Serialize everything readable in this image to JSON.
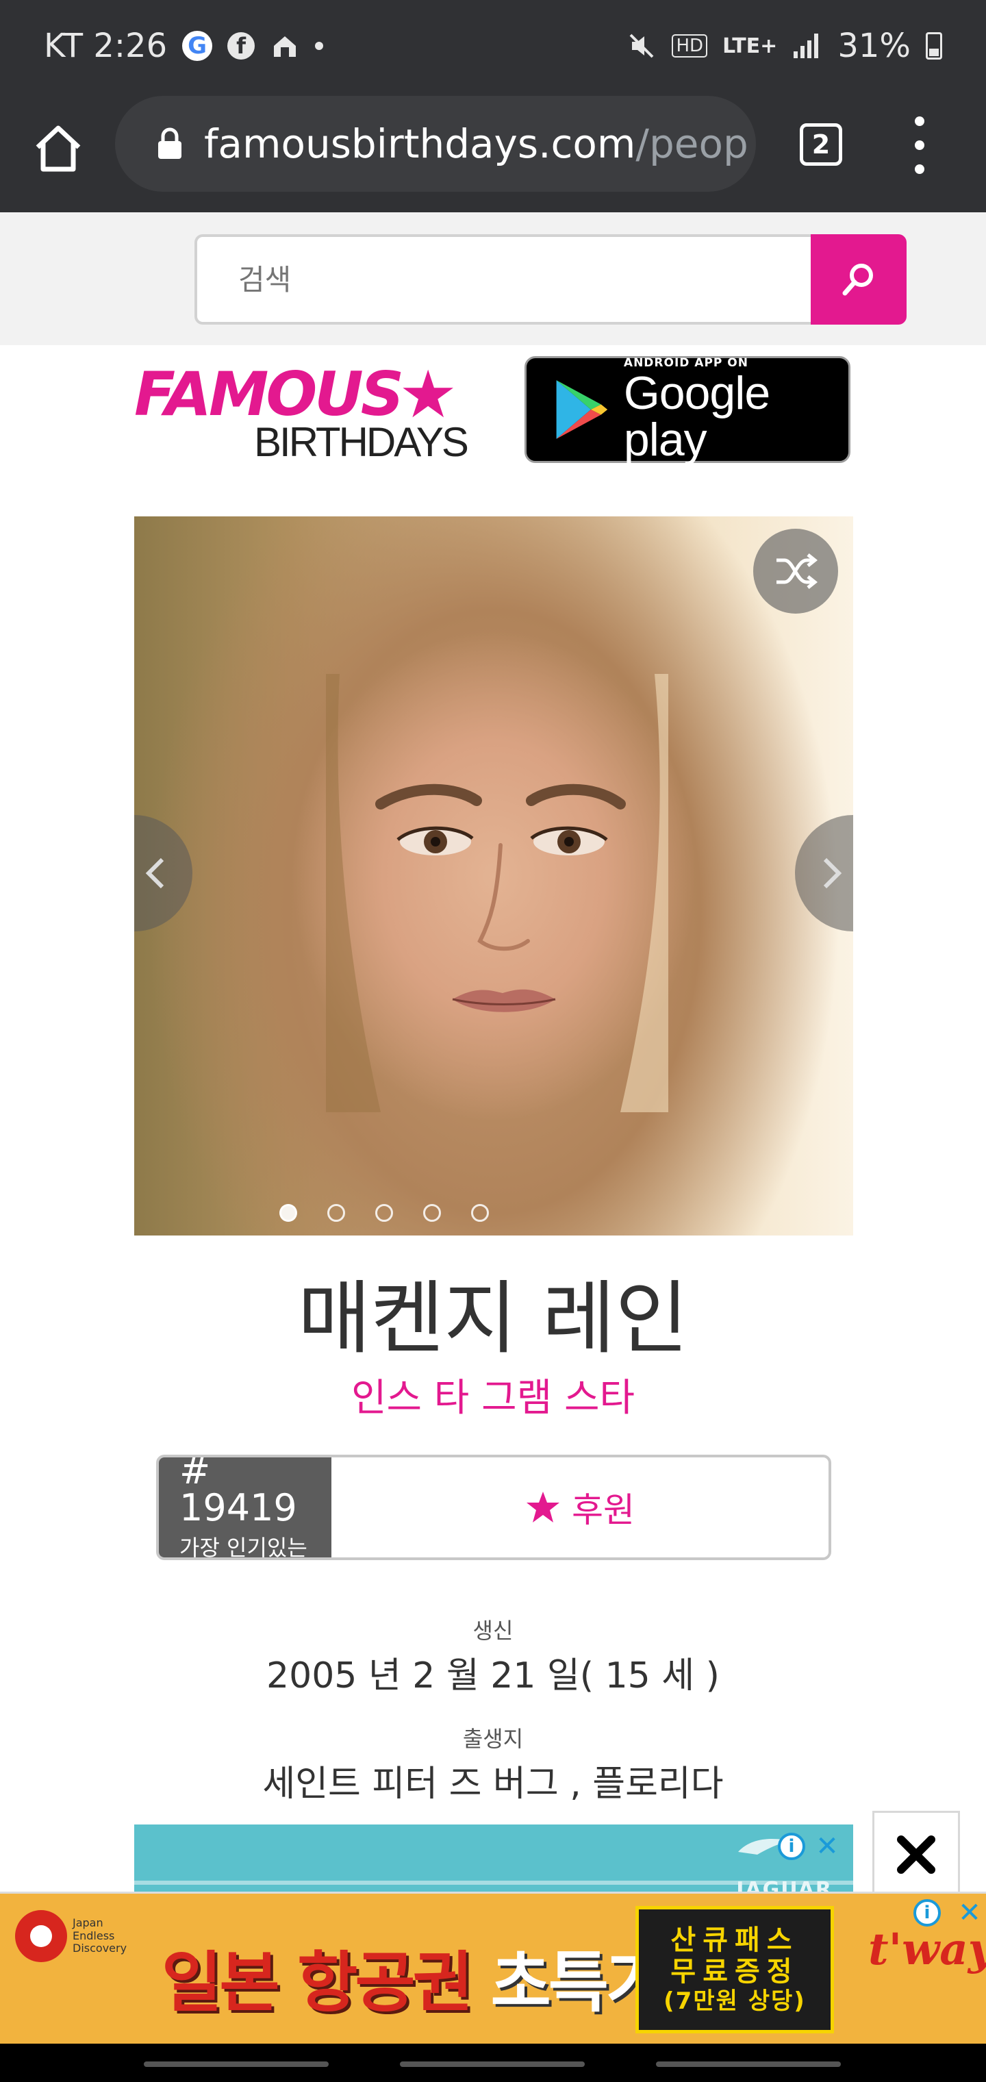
{
  "status_bar": {
    "carrier_time": "KT 2:26",
    "battery": "31%",
    "hd_label": "HD",
    "lte_label": "LTE+"
  },
  "browser": {
    "url_main": "famousbirthdays.com",
    "url_rest": "/peop",
    "tab_count": "2"
  },
  "search": {
    "placeholder": "검색"
  },
  "logo": {
    "famous": "FAMOUS",
    "birthdays": "BIRTHDAYS"
  },
  "google_play": {
    "small": "ANDROID APP ON",
    "big": "Google play"
  },
  "carousel": {
    "photo_count": 5,
    "active_index": 0
  },
  "profile": {
    "name": "매켄지 레인",
    "occupation": "인스 타 그램 스타",
    "rank_number": "# 19419",
    "rank_label": "가장 인기있는",
    "support_label": "후원",
    "birth_label": "생신",
    "birth_value": "2005 년 2 월 21 일( 15 세 )",
    "birthplace_label": "출생지",
    "birthplace_value": "세인트 피터 즈 버그 , 플로리다"
  },
  "ads": {
    "inline_brand": "JAGUAR",
    "bottom_brand_line1": "Japan",
    "bottom_brand_line2": "Endless",
    "bottom_brand_line3": "Discovery",
    "headline_part1": "일본 항공권",
    "headline_part2": "초특가",
    "promo_line1": "산큐패스",
    "promo_line2": "무료증정",
    "promo_line3": "(7만원 상당)",
    "airline": "t'way"
  },
  "colors": {
    "accent": "#e3198f",
    "status_bar": "#303134",
    "rank_badge": "#5c5c5c"
  }
}
